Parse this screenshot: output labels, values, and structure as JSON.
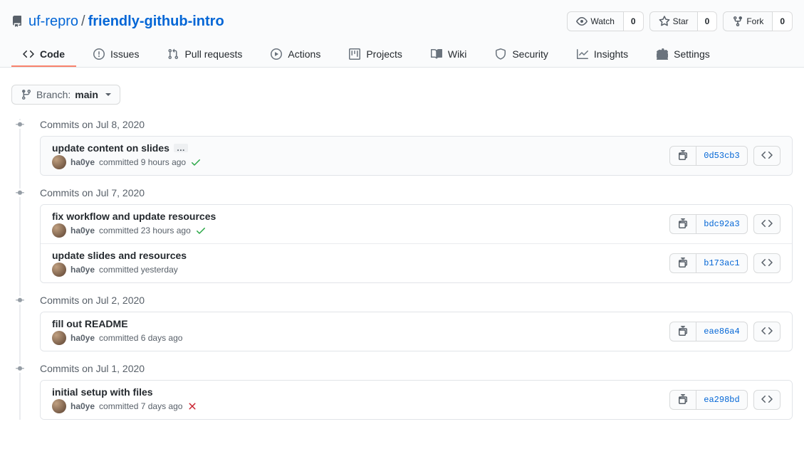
{
  "repo": {
    "owner": "uf-repro",
    "name": "friendly-github-intro"
  },
  "header_actions": {
    "watch": {
      "label": "Watch",
      "count": "0"
    },
    "star": {
      "label": "Star",
      "count": "0"
    },
    "fork": {
      "label": "Fork",
      "count": "0"
    }
  },
  "tabs": [
    {
      "label": "Code"
    },
    {
      "label": "Issues"
    },
    {
      "label": "Pull requests"
    },
    {
      "label": "Actions"
    },
    {
      "label": "Projects"
    },
    {
      "label": "Wiki"
    },
    {
      "label": "Security"
    },
    {
      "label": "Insights"
    },
    {
      "label": "Settings"
    }
  ],
  "branch": {
    "prefix": "Branch:",
    "name": "main"
  },
  "groups": [
    {
      "title": "Commits on Jul 8, 2020",
      "commits": [
        {
          "title": "update content on slides",
          "author": "ha0ye",
          "time": "committed 9 hours ago",
          "status": "success",
          "sha": "0d53cb3",
          "highlight": true,
          "show_ellipsis": true
        }
      ]
    },
    {
      "title": "Commits on Jul 7, 2020",
      "commits": [
        {
          "title": "fix workflow and update resources",
          "author": "ha0ye",
          "time": "committed 23 hours ago",
          "status": "success",
          "sha": "bdc92a3"
        },
        {
          "title": "update slides and resources",
          "author": "ha0ye",
          "time": "committed yesterday",
          "status": null,
          "sha": "b173ac1"
        }
      ]
    },
    {
      "title": "Commits on Jul 2, 2020",
      "commits": [
        {
          "title": "fill out README",
          "author": "ha0ye",
          "time": "committed 6 days ago",
          "status": null,
          "sha": "eae86a4"
        }
      ]
    },
    {
      "title": "Commits on Jul 1, 2020",
      "commits": [
        {
          "title": "initial setup with files",
          "author": "ha0ye",
          "time": "committed 7 days ago",
          "status": "failure",
          "sha": "ea298bd"
        }
      ]
    }
  ]
}
